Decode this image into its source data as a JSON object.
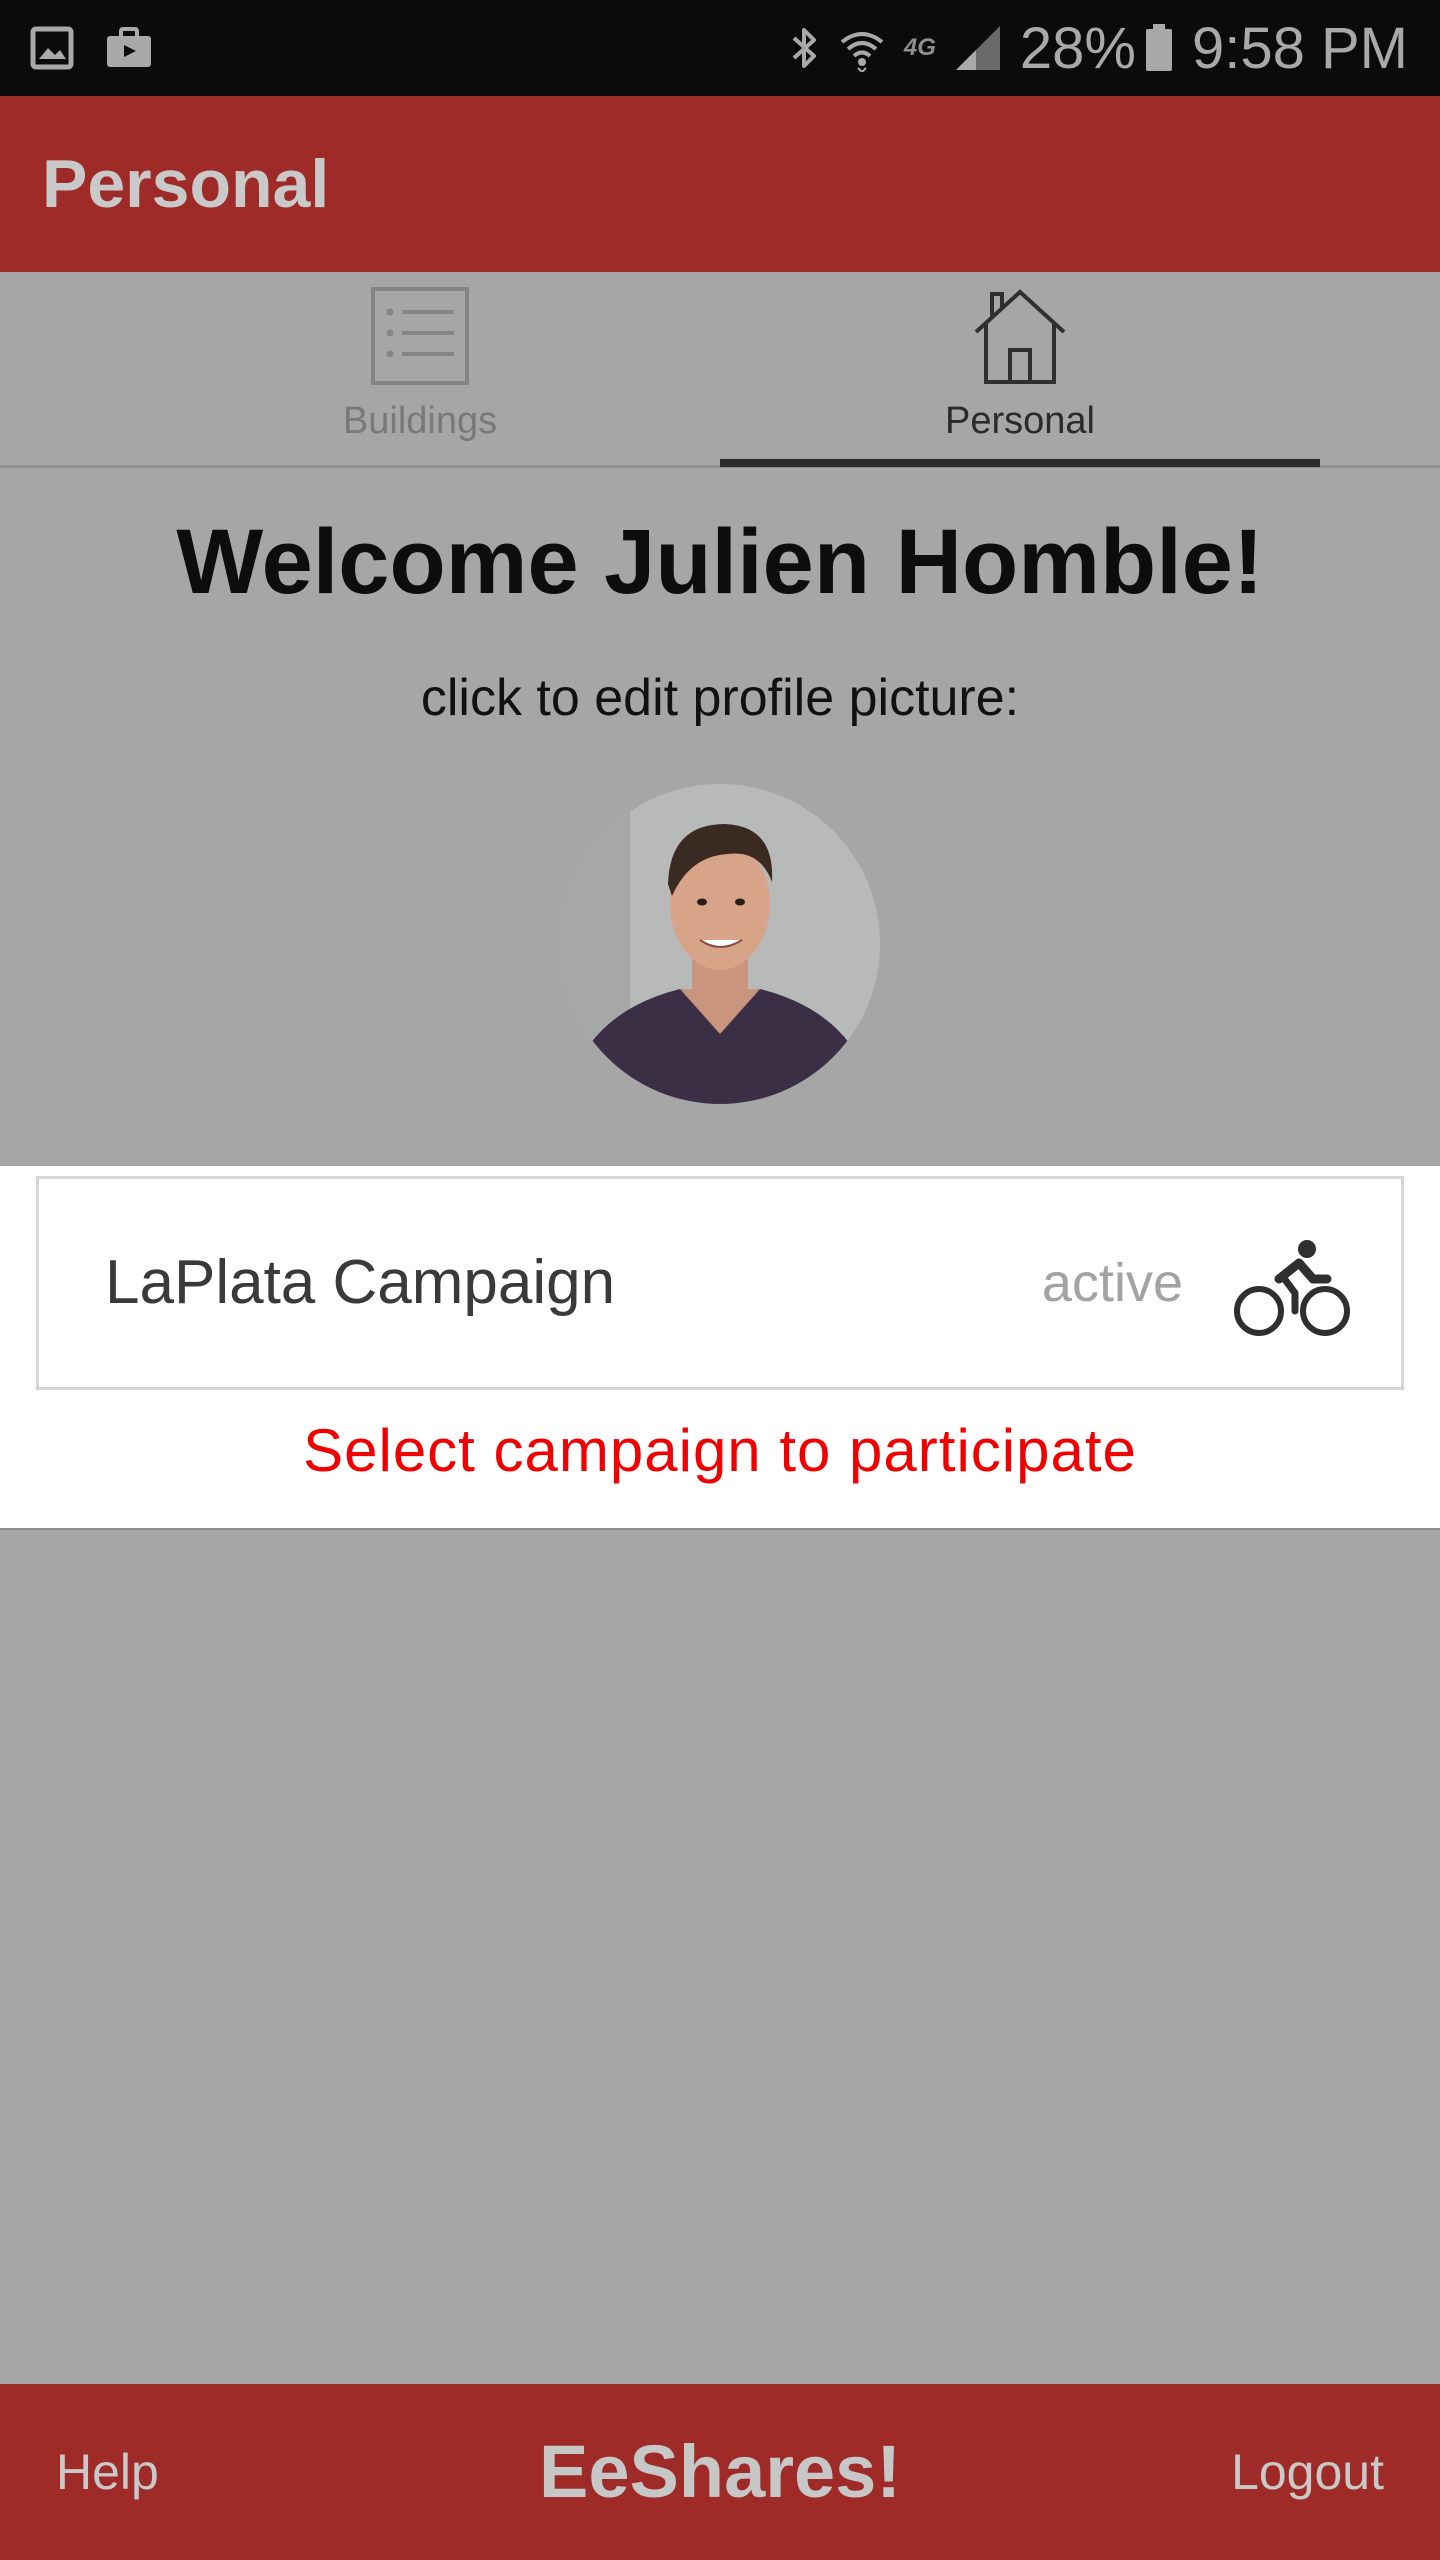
{
  "status_bar": {
    "left_icons": [
      "gallery-icon",
      "work-profile-icon"
    ],
    "right_icons": [
      "bluetooth-icon",
      "wifi-icon",
      "cell-signal-icon",
      "battery-icon"
    ],
    "network": "4G",
    "battery": "28%",
    "time": "9:58 PM"
  },
  "app_bar": {
    "title": "Personal",
    "color": "#9e2b27"
  },
  "tabs": [
    {
      "label": "Buildings",
      "icon": "list-icon",
      "selected": false
    },
    {
      "label": "Personal",
      "icon": "home-icon",
      "selected": true
    }
  ],
  "welcome": {
    "title": "Welcome Julien Homble!",
    "hint": "click to edit profile picture:"
  },
  "campaigns": [
    {
      "name": "LaPlata Campaign",
      "status": "active",
      "icon": "bicycle-icon"
    }
  ],
  "campaign_hint": "Select campaign to participate",
  "bottom_bar": {
    "help": "Help",
    "brand": "EeShares!",
    "logout": "Logout"
  }
}
